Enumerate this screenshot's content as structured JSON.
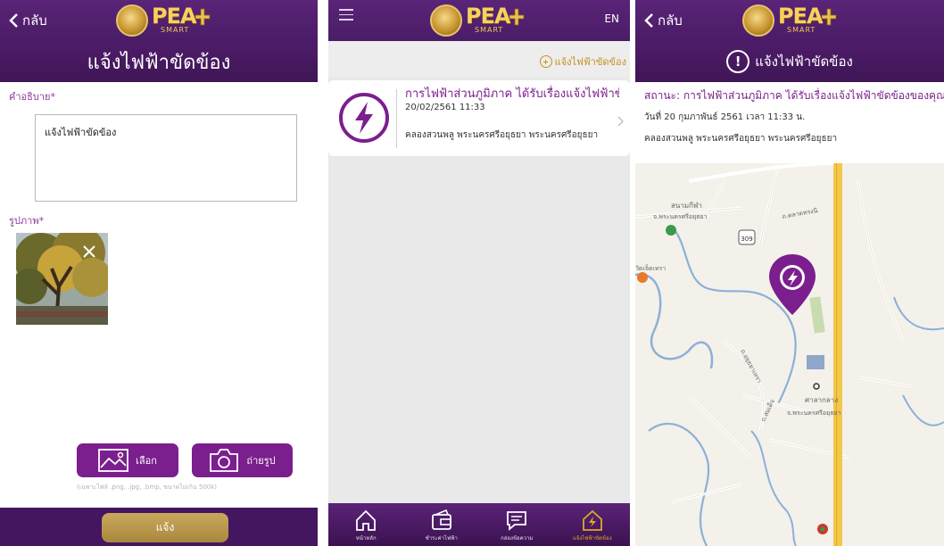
{
  "brand": {
    "wordmark": "PEA",
    "sub": "SMART"
  },
  "screen1": {
    "back_label": "กลับ",
    "title": "แจ้งไฟฟ้าขัดข้อง",
    "description_label": "คำอธิบาย*",
    "description_value": "แจ้งไฟฟ้าขัดข้อง",
    "photo_label": "รูปภาพ*",
    "choose_label": "เลือก",
    "camera_label": "ถ่ายรูป",
    "hint": "(เฉพาะไฟล์ .png, .jpg, .bmp, ขนาดไม่เกิน 500k)",
    "submit_label": "แจ้ง"
  },
  "screen2": {
    "lang": "EN",
    "add_report": "แจ้งไฟฟ้าขัดข้อง",
    "card": {
      "title": "การไฟฟ้าส่วนภูมิภาค ได้รับเรื่องแจ้งไฟฟ้าขัด...",
      "datetime": "20/02/2561 11:33",
      "location": "คลองสวนพลู พระนครศรีอยุธยา พระนครศรีอยุธยา"
    },
    "tabs": [
      {
        "label": "หน้าหลัก",
        "icon": "home-icon"
      },
      {
        "label": "ชำระค่าไฟฟ้า",
        "icon": "wallet-icon"
      },
      {
        "label": "กล่องข้อความ",
        "icon": "message-icon"
      },
      {
        "label": "แจ้งไฟฟ้าขัดข้อง",
        "icon": "outage-icon"
      }
    ]
  },
  "screen3": {
    "back_label": "กลับ",
    "title": "แจ้งไฟฟ้าขัดข้อง",
    "status": "สถานะ: การไฟฟ้าส่วนภูมิภาค ได้รับเรื่องแจ้งไฟฟ้าขัดข้องของคุณแล้ว",
    "date": "วันที่ 20 กุมภาพันธ์ 2561 เวลา 11:33 น.",
    "location": "คลองสวนพลู พระนครศรีอยุธยา พระนครศรีอยุธยา",
    "map_labels": {
      "airfield": "สนามกีฬา",
      "airfield_sub": "จ.พระนครศรีอยุธยา",
      "road1": "ถ.ตลาดทรงนิ",
      "route": "309",
      "hall": "ศาลากลาง",
      "hall_sub": "จ.พระนครศรีอยุธยา",
      "place_left": "วัดเจ็ดเทรา",
      "road2": "ถ.สมเด็จ",
      "road3": "ถ.อยุธยาเทรา"
    }
  },
  "colors": {
    "purple": "#7b1e8e",
    "dark_purple": "#451660",
    "gold": "#c8911d"
  }
}
